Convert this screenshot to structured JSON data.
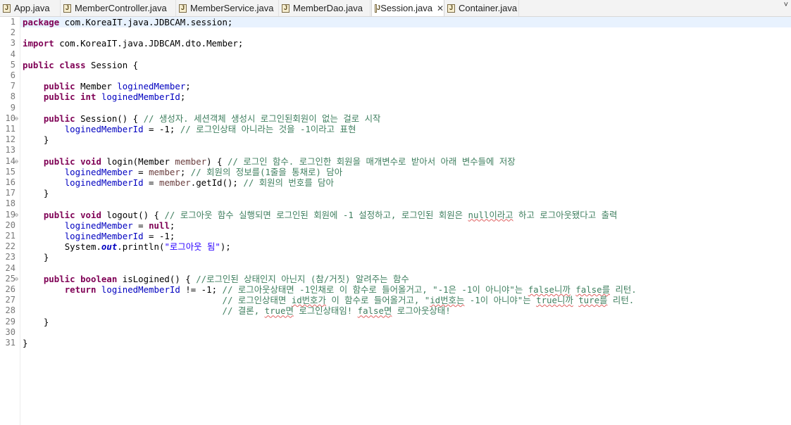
{
  "tabs": [
    {
      "label": "App.java",
      "active": false
    },
    {
      "label": "MemberController.java",
      "active": false
    },
    {
      "label": "MemberService.java",
      "active": false
    },
    {
      "label": "MemberDao.java",
      "active": false
    },
    {
      "label": "Session.java",
      "active": true
    },
    {
      "label": "Container.java",
      "active": false
    }
  ],
  "tab_close_glyph": "✕",
  "tab_menu_glyph": "˅",
  "line_numbers": [
    "1",
    "2",
    "3",
    "4",
    "5",
    "6",
    "7",
    "8",
    "9",
    "10",
    "11",
    "12",
    "13",
    "14",
    "15",
    "16",
    "17",
    "18",
    "19",
    "20",
    "21",
    "22",
    "23",
    "24",
    "25",
    "26",
    "27",
    "28",
    "29",
    "30",
    "31"
  ],
  "code": {
    "l1": "package com.KoreaIT.java.JDBCAM.session;",
    "l3": "import com.KoreaIT.java.JDBCAM.dto.Member;",
    "l5": "public class Session {",
    "l7": "    public Member loginedMember;",
    "l8": "    public int loginedMemberId;",
    "l10": "    public Session() { // 생성자. 세션객체 생성시 로그인된회원이 없는 걸로 시작",
    "l11": "        loginedMemberId = -1; // 로그인상태 아니라는 것을 -1이라고 표현",
    "l12": "    }",
    "l14": "    public void login(Member member) { // 로그인 함수. 로그인한 회원을 매개변수로 받아서 아래 변수들에 저장",
    "l15": "        loginedMember = member; // 회원의 정보를(1줄을 통채로) 담아",
    "l16": "        loginedMemberId = member.getId(); // 회원의 번호를 담아",
    "l17": "    }",
    "l19": "    public void logout() { // 로그아웃 함수 실행되면 로그인된 회원에 -1 설정하고, 로그인된 회원은 null이라고 하고 로그아웃됐다고 출력",
    "l20": "        loginedMember = null;",
    "l21": "        loginedMemberId = -1;",
    "l22": "        System.out.println(\"로그아웃 됨\");",
    "l23": "    }",
    "l25": "    public boolean isLogined() { //로그인된 상태인지 아닌지 (참/거짓) 알려주는 함수",
    "l26": "        return loginedMemberId != -1; // 로그아웃상태면 -1인채로 이 함수로 들어올거고, \"-1은 -1이 아니야\"는 false니까 false를 리턴.",
    "l27": "                                      // 로그인상태면 id번호가 이 함수로 들어올거고, \"id번호는 -1이 아니야\"는 true니까 ture를 리턴.",
    "l28": "                                      // 결론, true면 로그인상태임! false면 로그아웃상태!",
    "l29": "    }",
    "l31": "}"
  },
  "tokens": {
    "package_kw": "package",
    "pkg_name": " com.KoreaIT.java.JDBCAM.session;",
    "import_kw": "import",
    "import_name": " com.KoreaIT.java.JDBCAM.dto.Member;",
    "public_kw": "public",
    "class_kw": "class",
    "class_name": " Session {",
    "int_kw": "int",
    "void_kw": "void",
    "boolean_kw": "boolean",
    "return_kw": "return",
    "null_kw": "null",
    "member_type": " Member ",
    "field_member": "loginedMember",
    "field_id": "loginedMemberId",
    "semi": ";",
    "ctor_sig": " Session() { ",
    "c10": "// 생성자. 세션객체 생성시 로그인된회원이 없는 걸로 시작",
    "assign_m1": " = -1; ",
    "c11": "// 로그인상태 아니라는 것을 -1이라고 표현",
    "close_brace": "}",
    "login_sig_a": " login(Member ",
    "param_member": "member",
    "login_sig_b": ") { ",
    "c14": "// 로그인 함수. 로그인한 회원을 매개변수로 받아서 아래 변수들에 저장",
    "assign": " = ",
    "c15": "// 회원의 정보를(1줄을 통채로) 담아",
    "get_id": ".getId(); ",
    "c16": "// 회원의 번호를 담아",
    "logout_sig": " logout() { ",
    "c19a": "// 로그아웃 함수 실행되면 로그인된 회원에 -1 설정하고, 로그인된 회원은 ",
    "c19b": "null이라고",
    "c19c": " 하고 로그아웃됐다고 출력",
    "assign_m1_end": " = -1;",
    "sys": "System.",
    "out": "out",
    "println": ".println(",
    "str22": "\"로그아웃 됨\"",
    "println_end": ");",
    "isl_sig": " isLogined() { ",
    "c25": "//로그인된 상태인지 아닌지 (참/거짓) 알려주는 함수",
    "neq": " != -1; ",
    "c26a": "// 로그아웃상태면 -1인채로 이 함수로 들어올거고, \"-1은 -1이 아니야\"는 ",
    "c26b": "false니까",
    "c26c": " ",
    "c26d": "false를",
    "c26e": " 리턴.",
    "c27a": "// 로그인상태면 ",
    "c27b": "id번호가",
    "c27c": " 이 함수로 들어올거고, \"",
    "c27d": "id번호는",
    "c27e": " -1이 아니야\"는 ",
    "c27f": "true니까",
    "c27g": " ",
    "c27h": "ture를",
    "c27i": " 리턴.",
    "c28a": "// ",
    "c28b": "결론",
    "c28c": ", ",
    "c28d": "true면",
    "c28e": " 로그인상태임! ",
    "c28f": "false면",
    "c28g": " 로그아웃상태!"
  }
}
